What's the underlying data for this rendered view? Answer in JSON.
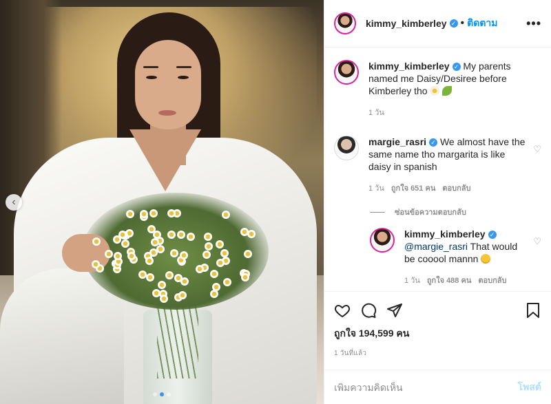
{
  "post": {
    "owner_username": "kimmy_kimberley",
    "follow_separator": "•",
    "follow_label": "ติดตาม",
    "more_label": "•••",
    "verified_glyph": "✓"
  },
  "comments": [
    {
      "username": "kimmy_kimberley",
      "text": "My parents named me Daisy/Desiree before Kimberley tho",
      "emojis": [
        "daisy-emoji",
        "leaf-emoji"
      ],
      "time": "1 วัน"
    },
    {
      "username": "margie_rasri",
      "text": "We almost have the same name tho margarita is like daisy in spanish",
      "time": "1 วัน",
      "likes": "ถูกใจ 651 คน",
      "reply_label": "ตอบกลับ",
      "view_replies_label": "ซ่อนข้อความตอบกลับ",
      "reply": {
        "username": "kimmy_kimberley",
        "mention": "@margie_rasri",
        "text": "That would be cooool mannn",
        "emoji": "laughing-emoji",
        "time": "1 วัน",
        "likes": "ถูกใจ 488 คน",
        "reply_label": "ตอบกลับ"
      }
    }
  ],
  "actions": {
    "like_icon": "heart-icon",
    "comment_icon": "comment-icon",
    "share_icon": "share-icon",
    "save_icon": "bookmark-icon"
  },
  "likes_text": "ถูกใจ 194,599 คน",
  "posted_time": "1 วันที่แล้ว",
  "add_comment": {
    "placeholder": "เพิ่มความคิดเห็น",
    "post_label": "โพสต์"
  },
  "photo": {
    "prev_icon": "chevron-left-icon",
    "prev_glyph": "‹",
    "slide_count": 3,
    "active_slide": 2
  },
  "colors": {
    "follow_blue": "#0095f6",
    "verified_blue": "#3897f0",
    "post_disabled": "#b2dffc",
    "meta_gray": "#8e8e8e"
  }
}
